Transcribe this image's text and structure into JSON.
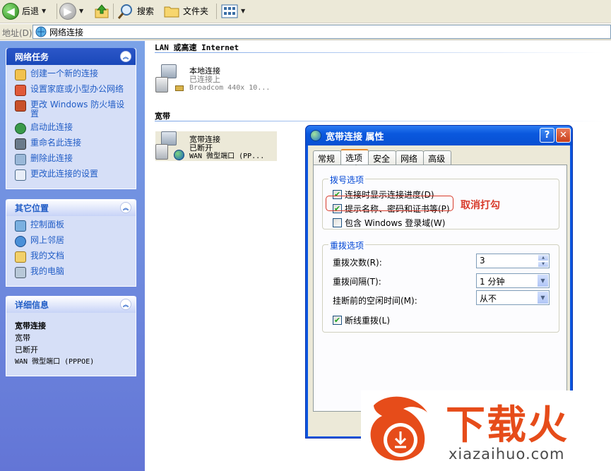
{
  "toolbar": {
    "back_label": "后退",
    "search_label": "搜索",
    "folders_label": "文件夹"
  },
  "address": {
    "label": "地址(D)",
    "value": "网络连接"
  },
  "left_pane": {
    "network_tasks": {
      "title": "网络任务",
      "items": [
        {
          "label": "创建一个新的连接",
          "icon": "new-connection-icon"
        },
        {
          "label": "设置家庭或小型办公网络",
          "icon": "home-network-icon"
        },
        {
          "label": "更改 Windows 防火墙设置",
          "icon": "firewall-icon"
        },
        {
          "label": "启动此连接",
          "icon": "start-connection-icon"
        },
        {
          "label": "重命名此连接",
          "icon": "rename-icon"
        },
        {
          "label": "删除此连接",
          "icon": "delete-icon"
        },
        {
          "label": "更改此连接的设置",
          "icon": "settings-icon"
        }
      ]
    },
    "other_places": {
      "title": "其它位置",
      "items": [
        {
          "label": "控制面板",
          "icon": "control-panel-icon"
        },
        {
          "label": "网上邻居",
          "icon": "network-places-icon"
        },
        {
          "label": "我的文档",
          "icon": "my-documents-icon"
        },
        {
          "label": "我的电脑",
          "icon": "my-computer-icon"
        }
      ]
    },
    "details": {
      "title": "详细信息",
      "lines": [
        "宽带连接",
        "宽带",
        "已断开",
        "WAN 微型端口 (PPPOE)"
      ]
    }
  },
  "content": {
    "lan_group": "LAN 或高速 Internet",
    "lan_conn": {
      "name": "本地连接",
      "status": "已连接上",
      "device": "Broadcom 440x 10..."
    },
    "broadband_group": "宽带",
    "broadband_conn": {
      "name": "宽带连接",
      "status": "已断开",
      "device": "WAN 微型端口 (PP..."
    }
  },
  "dialog": {
    "title": "宽带连接 属性",
    "tabs": [
      "常规",
      "选项",
      "安全",
      "网络",
      "高级"
    ],
    "active_tab": 1,
    "dial_group": "拨号选项",
    "dial_options": [
      {
        "label": "连接时显示连接进度(D)",
        "checked": true
      },
      {
        "label": "提示名称、密码和证书等(P)",
        "checked": true
      },
      {
        "label": "包含 Windows 登录域(W)",
        "checked": false
      }
    ],
    "redial_group": "重拨选项",
    "redial_attempts_label": "重拨次数(R):",
    "redial_attempts_value": "3",
    "redial_interval_label": "重拨间隔(T):",
    "redial_interval_value": "1 分钟",
    "idle_label": "挂断前的空闲时间(M):",
    "idle_value": "从不",
    "redial_on_drop": {
      "label": "断线重拨(L)",
      "checked": true
    },
    "help_glyph": "?",
    "close_glyph": "✕"
  },
  "annotation": "取消打勾",
  "watermark": {
    "brand": "下载火",
    "url": "xiazaihuo.com"
  },
  "colors": {
    "xp_blue": "#0a56e0",
    "link_blue": "#215dc6",
    "annotation_red": "#d83a2a",
    "watermark_orange": "#e64c1a"
  }
}
